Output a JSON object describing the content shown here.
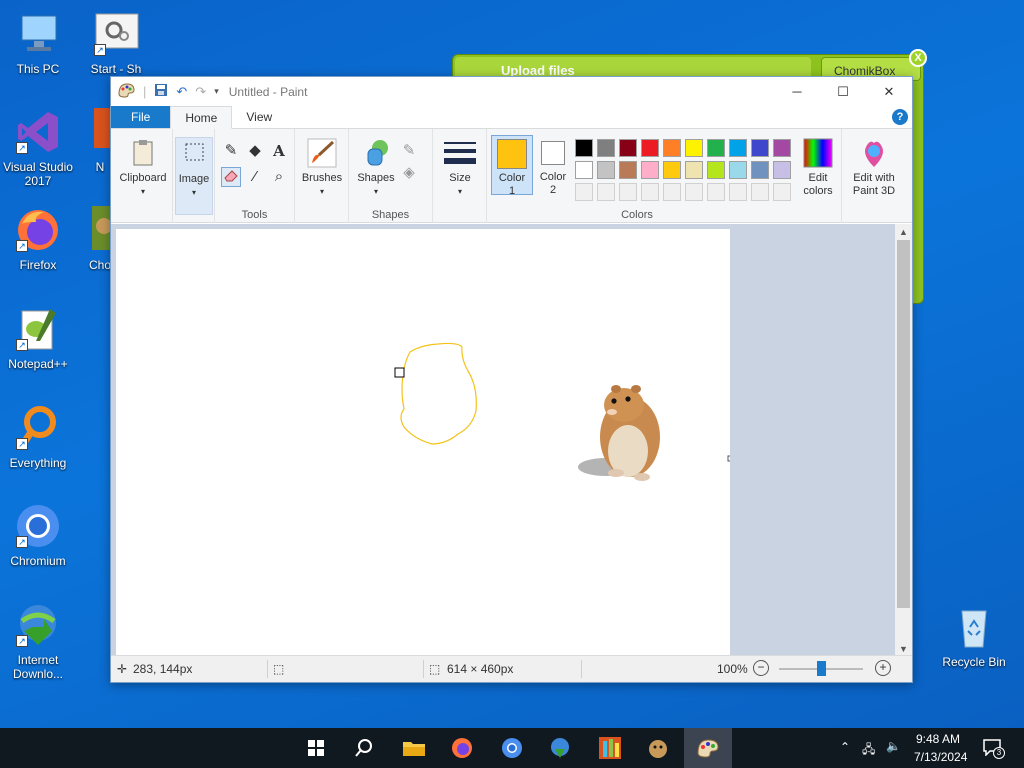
{
  "desktop": {
    "icons": [
      {
        "label": "This PC"
      },
      {
        "label": "Start - Sh"
      },
      {
        "label": "Visual Studio 2017"
      },
      {
        "label": "N"
      },
      {
        "label": "Firefox"
      },
      {
        "label": "Cho"
      },
      {
        "label": "Notepad++"
      },
      {
        "label": "Everything"
      },
      {
        "label": "Chromium"
      },
      {
        "label": "Internet Downlo..."
      },
      {
        "label": "Recycle Bin"
      }
    ]
  },
  "chomikbox": {
    "upload_label": "Upload files",
    "tab_label": "ChomikBox",
    "close": "X"
  },
  "paint": {
    "title": "Untitled - Paint",
    "tabs": {
      "file": "File",
      "home": "Home",
      "view": "View"
    },
    "help": "?",
    "ribbon": {
      "clipboard": "Clipboard",
      "image": "Image",
      "tools": "Tools",
      "brushes": "Brushes",
      "shapes_btn": "Shapes",
      "shapes_grp": "Shapes",
      "size": "Size",
      "color1_a": "Color",
      "color1_b": "1",
      "color2_a": "Color",
      "color2_b": "2",
      "colors": "Colors",
      "edit_colors_a": "Edit",
      "edit_colors_b": "colors",
      "paint3d_a": "Edit with",
      "paint3d_b": "Paint 3D"
    },
    "color1": "#ffc20e",
    "color2": "#ffffff",
    "palette_row1": [
      "#000000",
      "#7f7f7f",
      "#880015",
      "#ed1c24",
      "#ff7f27",
      "#fff200",
      "#22b14c",
      "#00a2e8",
      "#3f48cc",
      "#a349a4"
    ],
    "palette_row2": [
      "#ffffff",
      "#c3c3c3",
      "#b97a57",
      "#ffaec9",
      "#ffc90e",
      "#efe4b0",
      "#b5e61d",
      "#99d9ea",
      "#7092be",
      "#c8bfe7"
    ],
    "status": {
      "cursor": "283, 144px",
      "size": "614 × 460px",
      "zoom": "100%"
    }
  },
  "taskbar": {
    "time": "9:48 AM",
    "date": "7/13/2024",
    "notif_count": "3"
  }
}
